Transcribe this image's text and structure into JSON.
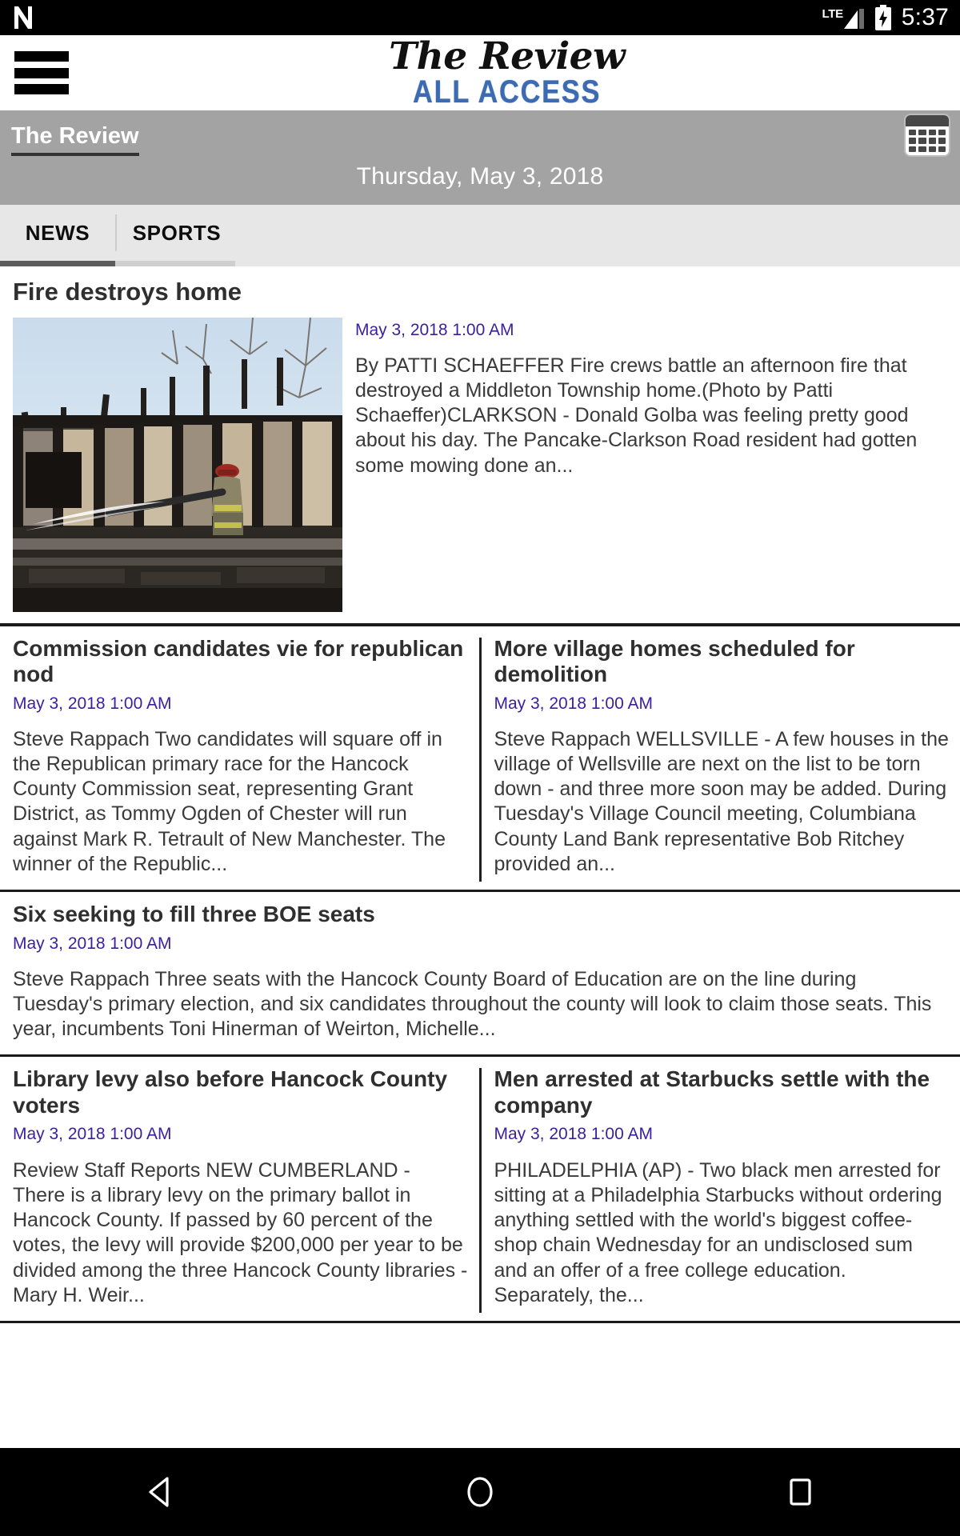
{
  "status_bar": {
    "app_icon": "netflix-n-icon",
    "network_label": "LTE",
    "signal_icon": "signal-bars-icon",
    "battery_icon": "battery-charging-icon",
    "time": "5:37"
  },
  "header": {
    "menu_icon": "hamburger-menu-icon",
    "logo_main": "The Review",
    "logo_sub": "ALL ACCESS"
  },
  "title_bar": {
    "site_name": "The Review",
    "date": "Thursday, May 3, 2018",
    "calendar_icon": "calendar-icon"
  },
  "tabs": [
    {
      "label": "NEWS",
      "active": true
    },
    {
      "label": "SPORTS",
      "active": false
    }
  ],
  "hero_article": {
    "title": "Fire destroys home",
    "timestamp": "May 3, 2018 1:00 AM",
    "image_alt": "firefighter-spraying-burned-house-photo",
    "summary": "By PATTI SCHAEFFER Fire crews battle an afternoon fire that destroyed a Middleton Township home.(Photo by Patti Schaeffer)CLARKSON - Donald Golba was feeling pretty good about his day. The Pancake-Clarkson Road resident had gotten some mowing done an..."
  },
  "articles_row1": [
    {
      "title": "Commission candidates vie for republican nod",
      "timestamp": "May 3, 2018 1:00 AM",
      "summary": "Steve Rappach Two candidates will square off in the Republican primary race for the Hancock County Commission seat, representing Grant District, as Tommy Ogden of Chester will run against Mark R. Tetrault of New Manchester. The winner of the Republic..."
    },
    {
      "title": "More village homes scheduled for demolition",
      "timestamp": "May 3, 2018 1:00 AM",
      "summary": "Steve Rappach WELLSVILLE - A few houses in the village of Wellsville are next on the list to be torn down - and three more soon may be added. During Tuesday's Village Council meeting, Columbiana County Land Bank representative Bob Ritchey provided an..."
    }
  ],
  "article_full": {
    "title": "Six seeking to fill three BOE seats",
    "timestamp": "May 3, 2018 1:00 AM",
    "summary": "Steve Rappach Three seats with the Hancock County Board of Education are on the line during Tuesday's primary election, and six candidates throughout the county will look to claim those seats. This year, incumbents Toni Hinerman of Weirton, Michelle..."
  },
  "articles_row2": [
    {
      "title": "Library levy also before Hancock County voters",
      "timestamp": "May 3, 2018 1:00 AM",
      "summary": "Review Staff Reports NEW CUMBERLAND - There is a library levy on the primary ballot in Hancock County. If passed by 60 percent of the votes, the levy will provide $200,000 per year to be divided among the three Hancock County libraries - Mary H. Weir..."
    },
    {
      "title": "Men arrested at Starbucks settle with the company",
      "timestamp": "May 3, 2018 1:00 AM",
      "summary": "PHILADELPHIA (AP) - Two black men arrested for sitting at a Philadelphia Starbucks without ordering anything settled with the world's biggest coffee-shop chain Wednesday for an undisclosed sum and an offer of a free college education. Separately, the..."
    }
  ],
  "nav_bar": {
    "back_icon": "back-triangle-icon",
    "home_icon": "home-circle-icon",
    "recents_icon": "recents-square-icon"
  },
  "colors": {
    "accent_blue": "#3d6bb3",
    "link_purple": "#3a1f9e",
    "gray_bar": "#a3a3a3",
    "tab_bg": "#e7e7e7"
  }
}
